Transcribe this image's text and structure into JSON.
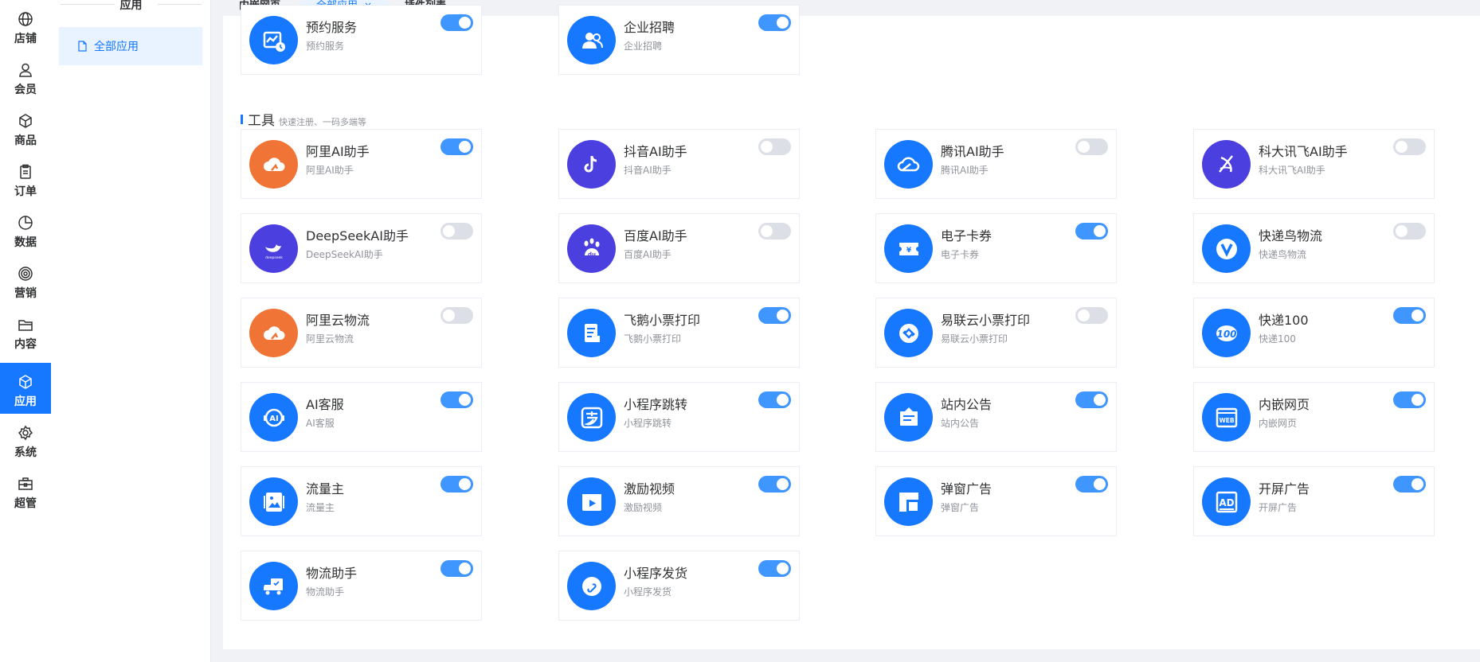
{
  "nav": [
    {
      "label": "店铺",
      "icon": "globe-icon"
    },
    {
      "label": "会员",
      "icon": "user-icon"
    },
    {
      "label": "商品",
      "icon": "box-icon"
    },
    {
      "label": "订单",
      "icon": "clipboard-icon"
    },
    {
      "label": "数据",
      "icon": "pie-chart-icon"
    },
    {
      "label": "营销",
      "icon": "target-icon"
    },
    {
      "label": "内容",
      "icon": "folder-icon"
    },
    {
      "label": "应用",
      "icon": "cube-icon",
      "active": true
    },
    {
      "label": "系统",
      "icon": "gear-icon"
    },
    {
      "label": "超管",
      "icon": "toolbox-icon"
    }
  ],
  "sub": {
    "title": "应用",
    "item": "全部应用"
  },
  "tabs": [
    {
      "label": "内嵌网页"
    },
    {
      "label": "全部应用",
      "active": true,
      "close": "×"
    },
    {
      "label": "插件列表"
    }
  ],
  "colors": {
    "accent": "#1677ff",
    "orange": "#ef7436",
    "purple": "#4b3fe0",
    "toggle_on": "#4096ff",
    "toggle_off": "#dcdfe6"
  },
  "section_tools": {
    "title": "工具",
    "desc": "快速注册、一码多端等"
  },
  "top_cards": [
    {
      "name": "预约服务",
      "desc": "预约服务",
      "on": true,
      "icon": "appointment-icon",
      "color": "#1677ff"
    },
    {
      "name": "企业招聘",
      "desc": "企业招聘",
      "on": true,
      "icon": "users-icon",
      "color": "#1677ff"
    }
  ],
  "tool_cards": [
    {
      "name": "阿里AI助手",
      "desc": "阿里AI助手",
      "on": true,
      "icon": "aliyun-cloud-icon",
      "color": "#ef7436"
    },
    {
      "name": "抖音AI助手",
      "desc": "抖音AI助手",
      "on": false,
      "icon": "douyin-icon",
      "color": "#4b3fe0"
    },
    {
      "name": "腾讯AI助手",
      "desc": "腾讯AI助手",
      "on": false,
      "icon": "tencent-cloud-icon",
      "color": "#1677ff"
    },
    {
      "name": "科大讯飞AI助手",
      "desc": "科大讯飞AI助手",
      "on": false,
      "icon": "iflytek-icon",
      "color": "#4b3fe0"
    },
    {
      "name": "DeepSeekAI助手",
      "desc": "DeepSeekAI助手",
      "on": false,
      "icon": "deepseek-whale-icon",
      "color": "#4b3fe0"
    },
    {
      "name": "百度AI助手",
      "desc": "百度AI助手",
      "on": false,
      "icon": "baidu-paw-icon",
      "color": "#4b3fe0"
    },
    {
      "name": "电子卡券",
      "desc": "电子卡券",
      "on": true,
      "icon": "coupon-icon",
      "color": "#1677ff"
    },
    {
      "name": "快递鸟物流",
      "desc": "快递鸟物流",
      "on": false,
      "icon": "kdniao-icon",
      "color": "#1677ff"
    },
    {
      "name": "阿里云物流",
      "desc": "阿里云物流",
      "on": false,
      "icon": "aliyun-cloud-icon",
      "color": "#ef7436"
    },
    {
      "name": "飞鹅小票打印",
      "desc": "飞鹅小票打印",
      "on": true,
      "icon": "receipt-icon",
      "color": "#1677ff"
    },
    {
      "name": "易联云小票打印",
      "desc": "易联云小票打印",
      "on": false,
      "icon": "yilianyun-icon",
      "color": "#1677ff"
    },
    {
      "name": "快递100",
      "desc": "快递100",
      "on": true,
      "icon": "kuaidi100-icon",
      "color": "#1677ff"
    },
    {
      "name": "AI客服",
      "desc": "AI客服",
      "on": true,
      "icon": "ai-service-icon",
      "color": "#1677ff"
    },
    {
      "name": "小程序跳转",
      "desc": "小程序跳转",
      "on": true,
      "icon": "alipay-icon",
      "color": "#1677ff"
    },
    {
      "name": "站内公告",
      "desc": "站内公告",
      "on": true,
      "icon": "notice-icon",
      "color": "#1677ff"
    },
    {
      "name": "内嵌网页",
      "desc": "内嵌网页",
      "on": true,
      "icon": "web-icon",
      "color": "#1677ff"
    },
    {
      "name": "流量主",
      "desc": "流量主",
      "on": true,
      "icon": "picture-icon",
      "color": "#1677ff"
    },
    {
      "name": "激励视频",
      "desc": "激励视频",
      "on": true,
      "icon": "video-icon",
      "color": "#1677ff"
    },
    {
      "name": "弹窗广告",
      "desc": "弹窗广告",
      "on": true,
      "icon": "popup-icon",
      "color": "#1677ff"
    },
    {
      "name": "开屏广告",
      "desc": "开屏广告",
      "on": true,
      "icon": "ad-icon",
      "color": "#1677ff"
    },
    {
      "name": "物流助手",
      "desc": "物流助手",
      "on": true,
      "icon": "truck-icon",
      "color": "#1677ff"
    },
    {
      "name": "小程序发货",
      "desc": "小程序发货",
      "on": true,
      "icon": "link-icon",
      "color": "#1677ff"
    }
  ]
}
